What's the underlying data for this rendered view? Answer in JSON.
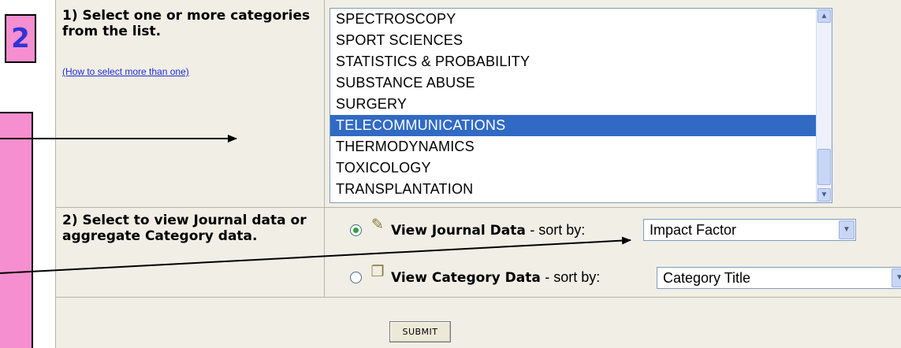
{
  "step_badge": "2",
  "step1": {
    "label": "1) Select one or more categories from the list.",
    "help_link": "(How to select more than one)"
  },
  "categories": {
    "items": [
      "SPECTROSCOPY",
      "SPORT SCIENCES",
      "STATISTICS & PROBABILITY",
      "SUBSTANCE ABUSE",
      "SURGERY",
      "TELECOMMUNICATIONS",
      "THERMODYNAMICS",
      "TOXICOLOGY",
      "TRANSPLANTATION"
    ],
    "selected_index": 5
  },
  "step2": {
    "label": "2) Select to view Journal data or aggregate Category data.",
    "journal_option": {
      "title": "View Journal Data",
      "sort_prefix": "- sort by:",
      "sort_value": "Impact Factor",
      "checked": true,
      "icon": "notepad-icon"
    },
    "category_option": {
      "title": "View Category Data",
      "sort_prefix": "- sort by:",
      "sort_value": "Category Title",
      "checked": false,
      "icon": "category-binder-icon"
    }
  },
  "submit_label": "SUBMIT",
  "colors": {
    "annotation_pink": "#f58fd0",
    "badge_text": "#2f34d6",
    "selection_blue": "#316ac5",
    "panel_bg": "#f0eee5",
    "link_blue": "#1f2bd1"
  }
}
